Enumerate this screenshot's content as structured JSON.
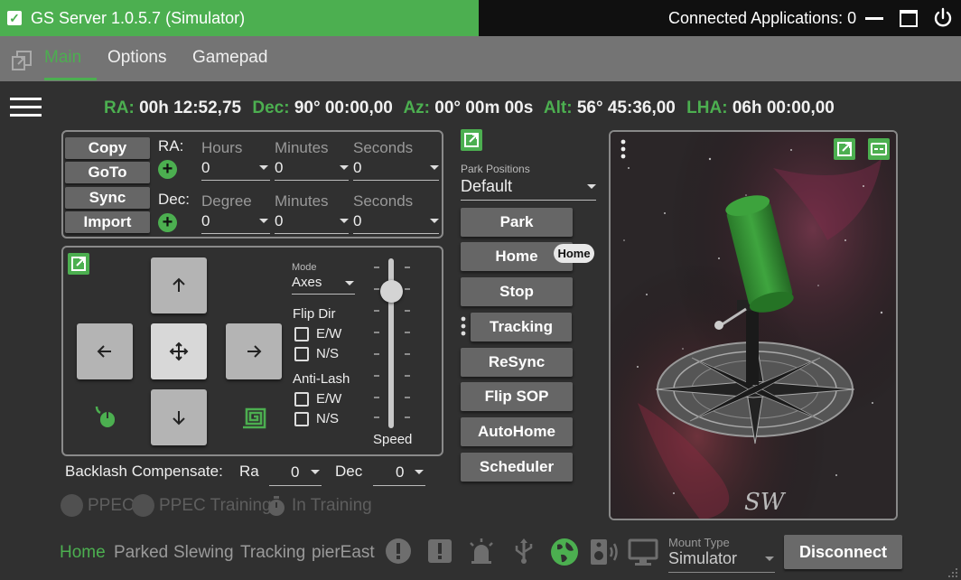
{
  "window": {
    "title": "GS Server 1.0.5.7 (Simulator)",
    "connected_applications": "Connected Applications: 0"
  },
  "tabs": [
    {
      "label": "Main",
      "active": true
    },
    {
      "label": "Options",
      "active": false
    },
    {
      "label": "Gamepad",
      "active": false
    }
  ],
  "coords": {
    "ra_label": "RA:",
    "ra_value": "00h 12:52,75",
    "dec_label": "Dec:",
    "dec_value": "90° 00:00,00",
    "az_label": "Az:",
    "az_value": "00° 00m 00s",
    "alt_label": "Alt:",
    "alt_value": "56° 45:36,00",
    "lha_label": "LHA:",
    "lha_value": "06h 00:00,00"
  },
  "goto": {
    "copy_label": "Copy",
    "goto_label": "GoTo",
    "sync_label": "Sync",
    "import_label": "Import",
    "ra_label": "RA:",
    "dec_label": "Dec:",
    "ra_fields": [
      {
        "hint": "Hours",
        "value": "0"
      },
      {
        "hint": "Minutes",
        "value": "0"
      },
      {
        "hint": "Seconds",
        "value": "0"
      }
    ],
    "dec_fields": [
      {
        "hint": "Degree",
        "value": "0"
      },
      {
        "hint": "Minutes",
        "value": "0"
      },
      {
        "hint": "Seconds",
        "value": "0"
      }
    ]
  },
  "hand_control": {
    "mode_label": "Mode",
    "mode_value": "Axes",
    "flip_dir_label": "Flip Dir",
    "anti_lash_label": "Anti-Lash",
    "ew_label": "E/W",
    "ns_label": "N/S",
    "speed_label": "Speed",
    "speed_level": 0.85
  },
  "backlash": {
    "label": "Backlash Compensate:",
    "ra_label": "Ra",
    "ra_value": "0",
    "dec_label": "Dec",
    "dec_value": "0"
  },
  "ppec": {
    "ppec_label": "PPEC",
    "training_label": "PPEC Training",
    "in_training_label": "In Training"
  },
  "park": {
    "positions_label": "Park Positions",
    "positions_value": "Default",
    "park_label": "Park",
    "home_label": "Home",
    "home_tooltip": "Home",
    "stop_label": "Stop",
    "tracking_label": "Tracking",
    "resync_label": "ReSync",
    "flip_sop_label": "Flip SOP",
    "autohome_label": "AutoHome",
    "scheduler_label": "Scheduler"
  },
  "status": {
    "home": "Home",
    "parked": "Parked",
    "slewing": "Slewing",
    "tracking": "Tracking",
    "pier": "pierEast",
    "mount_type_label": "Mount Type",
    "mount_type_value": "Simulator",
    "disconnect_label": "Disconnect"
  },
  "colors": {
    "accent": "#4caf50",
    "background": "#303030",
    "tab_bar": "#747474",
    "button": "#666666"
  }
}
